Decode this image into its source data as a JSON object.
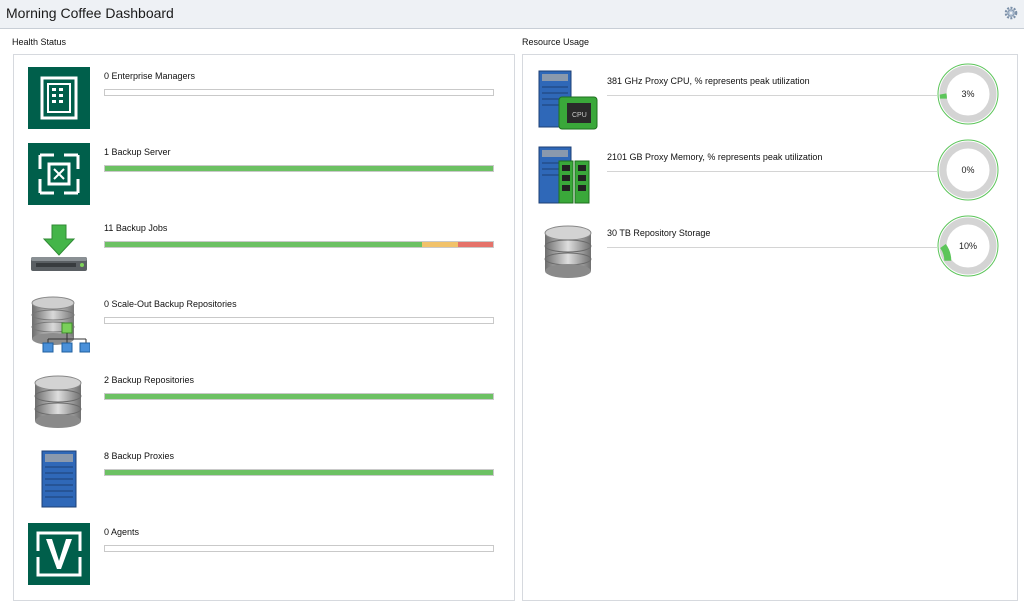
{
  "window": {
    "title": "Morning Coffee Dashboard"
  },
  "health": {
    "label": "Health Status",
    "items": [
      {
        "label": "0 Enterprise Managers",
        "icon": "enterprise-manager-icon",
        "fill": 0,
        "segments": []
      },
      {
        "label": "1 Backup Server",
        "icon": "backup-server-icon",
        "fill": 1,
        "segments": [
          {
            "color": "#6cc163",
            "fraction": 1
          }
        ]
      },
      {
        "label": "11 Backup Jobs",
        "icon": "backup-jobs-icon",
        "segments": [
          {
            "color": "#6cc163",
            "fraction": 0.818
          },
          {
            "color": "#f1c26a",
            "fraction": 0.091
          },
          {
            "color": "#e5726a",
            "fraction": 0.091
          }
        ]
      },
      {
        "label": "0 Scale-Out Backup Repositories",
        "icon": "scale-out-repository-icon",
        "fill": 0,
        "segments": []
      },
      {
        "label": "2 Backup Repositories",
        "icon": "backup-repository-icon",
        "fill": 1,
        "segments": [
          {
            "color": "#6cc163",
            "fraction": 1
          }
        ]
      },
      {
        "label": "8 Backup Proxies",
        "icon": "backup-proxy-icon",
        "fill": 1,
        "segments": [
          {
            "color": "#6cc163",
            "fraction": 1
          }
        ]
      },
      {
        "label": "0 Agents",
        "icon": "agents-icon",
        "fill": 0,
        "segments": []
      }
    ]
  },
  "resource": {
    "label": "Resource Usage",
    "items": [
      {
        "label": "381 GHz Proxy CPU, % represents peak utilization",
        "icon": "proxy-cpu-icon",
        "percent_text": "3%",
        "percent": 0.03
      },
      {
        "label": "2101 GB Proxy Memory, % represents peak utilization",
        "icon": "proxy-memory-icon",
        "percent_text": "0%",
        "percent": 0
      },
      {
        "label": "30 TB Repository Storage",
        "icon": "repository-storage-icon",
        "percent_text": "10%",
        "percent": 0.1
      }
    ]
  },
  "colors": {
    "veeam_green": "#005f4b",
    "bar_green": "#6cc163",
    "bar_yellow": "#f1c26a",
    "bar_red": "#e5726a",
    "gauge_green": "#5cc55a"
  }
}
